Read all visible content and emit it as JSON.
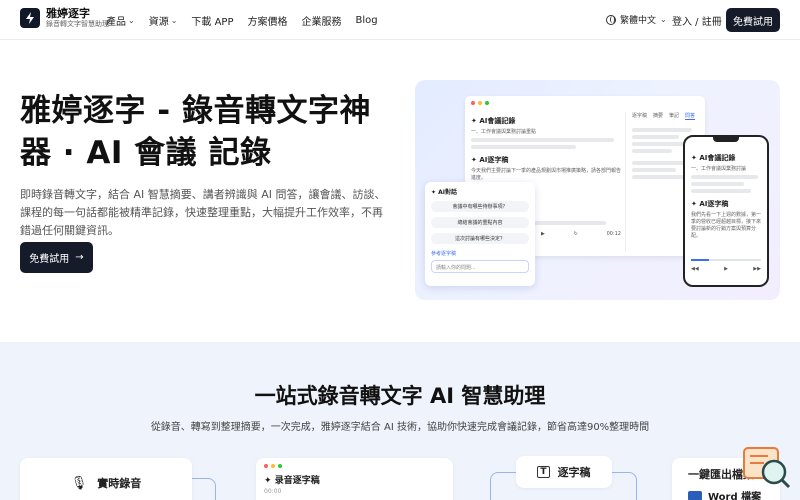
{
  "nav": {
    "brand_name": "雅婷逐字",
    "brand_sub": "錄音轉文字智慧助理",
    "links": [
      {
        "label": "產品",
        "dropdown": true
      },
      {
        "label": "資源",
        "dropdown": true
      },
      {
        "label": "下載 APP",
        "dropdown": false
      },
      {
        "label": "方案價格",
        "dropdown": false
      },
      {
        "label": "企業服務",
        "dropdown": false
      },
      {
        "label": "Blog",
        "dropdown": false
      }
    ],
    "language": "繁體中文",
    "login": "登入 / 註冊",
    "trial_button": "免費試用"
  },
  "hero": {
    "title": "雅婷逐字 - 錄音轉文字神器 · AI 會議 記錄",
    "description": "即時錄音轉文字，結合 AI 智慧摘要、講者辨識與 AI 問答，讓會議、訪談、課程的每一句話都能被精準記錄，快速整理重點，大幅提升工作效率，不再錯過任何關鍵資訊。",
    "cta_label": "免費試用"
  },
  "mock": {
    "record_title": "AI會議記錄",
    "record_sub": "一、工作會議與業務討論重點",
    "transcript_title": "AI逐字稿",
    "transcript_text": "今天我們主要討論下一季的產品規劃與市場推廣策略，請各部門報告進度。",
    "tabs": [
      "逐字稿",
      "摘要",
      "筆記",
      "問答"
    ],
    "chat_title": "AI對話",
    "chat_bubbles": [
      "會議中有哪些待辦事項？",
      "總結會議的重點內容",
      "這次討論有哪些決定？"
    ],
    "chat_tag": "參考逐字稿",
    "chat_placeholder": "請輸入你的問題...",
    "time": "00:12",
    "phone_record_title": "AI會議記錄",
    "phone_record_sub": "一、工作會議與業務討論",
    "phone_transcript_title": "AI逐字稿",
    "phone_transcript_text": "我們先看一下上週的數據，第一季的營收已經超越目標，接下來要討論新的行銷方案與預算分配。"
  },
  "features": {
    "title": "一站式錄音轉文字 AI 智慧助理",
    "subtitle": "從錄音、轉寫到整理摘要，一次完成，雅婷逐字結合 AI 技術，協助你快速完成會議記錄，節省高達90%整理時間",
    "cards": {
      "record": "實時錄音",
      "transcript_window": "录音逐字稿",
      "transcript_window_sub": "00:00",
      "transcript": "逐字稿",
      "export": "一鍵匯出檔案",
      "export_sub": "Word 檔案"
    }
  },
  "colors": {
    "primary_dark": "#151b29",
    "accent_blue": "#3b6ef5",
    "section_bg": "#eef3fc"
  }
}
